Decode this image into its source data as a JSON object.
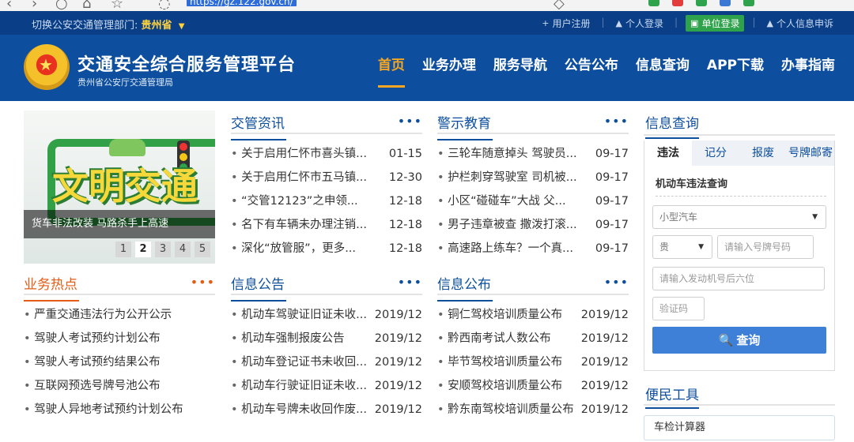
{
  "browser": {
    "url": "https://gz.122.gov.cn/",
    "ext_colors": [
      "#2fa34b",
      "#e33c3c",
      "#2fa34b",
      "#3a78d4",
      "#2fa34b"
    ]
  },
  "topbar": {
    "dept_label": "切换公安交通管理部门:",
    "province": "贵州省",
    "links": [
      {
        "label": "用户注册",
        "icon": "plus-icon",
        "glyph": "+"
      },
      {
        "label": "个人登录",
        "icon": "user-icon",
        "glyph": "▲"
      },
      {
        "label": "单位登录",
        "icon": "building-icon",
        "glyph": "▣"
      },
      {
        "label": "个人信息申诉",
        "icon": "user-icon",
        "glyph": "▲"
      }
    ]
  },
  "header": {
    "title": "交通安全综合服务管理平台",
    "subtitle": "贵州省公安厅交通管理局",
    "nav": [
      "首页",
      "业务办理",
      "服务导航",
      "公告公布",
      "信息查询",
      "APP下载",
      "办事指南"
    ]
  },
  "carousel": {
    "caption": "货车非法改装 马路杀手上高速",
    "banner_text": "文明交通",
    "pages": [
      "1",
      "2",
      "3",
      "4",
      "5"
    ],
    "active_page": "2"
  },
  "business_hot": {
    "title": "业务热点",
    "more": "•••",
    "items": [
      "严重交通违法行为公开公示",
      "驾驶人考试预约计划公布",
      "驾驶人考试预约结果公布",
      "互联网预选号牌号池公布",
      "驾驶人异地考试预约计划公布"
    ]
  },
  "traffic_news": {
    "title": "交管资讯",
    "more": "•••",
    "items": [
      {
        "t": "关于启用仁怀市喜头镇...",
        "d": "01-15"
      },
      {
        "t": "关于启用仁怀市五马镇...",
        "d": "12-30"
      },
      {
        "t": "“交管12123”之申领...",
        "d": "12-18"
      },
      {
        "t": "名下有车辆未办理注销...",
        "d": "12-18"
      },
      {
        "t": "深化“放管服”，更多...",
        "d": "12-18"
      }
    ]
  },
  "warning_edu": {
    "title": "警示教育",
    "more": "•••",
    "items": [
      {
        "t": "三轮车随意掉头 驾驶员...",
        "d": "09-17"
      },
      {
        "t": "护栏刺穿驾驶室 司机被...",
        "d": "09-17"
      },
      {
        "t": "小区“碰碰车”大战 父...",
        "d": "09-17"
      },
      {
        "t": "男子违章被查 撒泼打滚...",
        "d": "09-17"
      },
      {
        "t": "高速路上练车？一个真...",
        "d": "09-17"
      }
    ]
  },
  "info_notice": {
    "title": "信息公告",
    "more": "•••",
    "items": [
      {
        "t": "机动车驾驶证旧证未收...",
        "d": "2019/12"
      },
      {
        "t": "机动车强制报废公告",
        "d": "2019/12"
      },
      {
        "t": "机动车登记证书未收回...",
        "d": "2019/12"
      },
      {
        "t": "机动车行驶证旧证未收...",
        "d": "2019/12"
      },
      {
        "t": "机动车号牌未收回作废...",
        "d": "2019/12"
      }
    ]
  },
  "info_publish": {
    "title": "信息公布",
    "more": "•••",
    "items": [
      {
        "t": "铜仁驾校培训质量公布",
        "d": "2019/12"
      },
      {
        "t": "黔西南考试人数公布",
        "d": "2019/12"
      },
      {
        "t": "毕节驾校培训质量公布",
        "d": "2019/12"
      },
      {
        "t": "安顺驾校培训质量公布",
        "d": "2019/12"
      },
      {
        "t": "黔东南驾校培训质量公布",
        "d": "2019/12"
      }
    ]
  },
  "query": {
    "title": "信息查询",
    "tabs": [
      "违法",
      "记分",
      "报废",
      "号牌邮寄"
    ],
    "subtitle": "机动车违法查询",
    "vehicle_type": "小型汽车",
    "plate_prefix": "贵",
    "plate_placeholder": "请输入号牌号码",
    "engine_placeholder": "请输入发动机号后六位",
    "captcha_placeholder": "验证码",
    "button": "查询"
  },
  "tools": {
    "title": "便民工具",
    "items": [
      "车检计算器"
    ]
  }
}
